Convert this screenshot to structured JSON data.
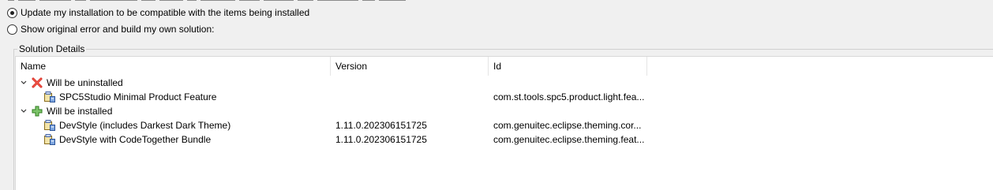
{
  "options": {
    "update_label": "Update my installation to be compatible with the items being installed",
    "update_selected": true,
    "show_error_label": "Show original error and build my own solution:",
    "show_error_selected": false
  },
  "solution": {
    "legend": "Solution Details",
    "columns": {
      "name": "Name",
      "version": "Version",
      "id": "Id"
    },
    "groups": [
      {
        "label": "Will be uninstalled",
        "icon": "red-x-icon",
        "expanded": true,
        "items": [
          {
            "name": "SPC5Studio Minimal Product Feature",
            "version": "",
            "id": "com.st.tools.spc5.product.light.fea..."
          }
        ]
      },
      {
        "label": "Will be installed",
        "icon": "green-plus-icon",
        "expanded": true,
        "items": [
          {
            "name": "DevStyle (includes Darkest Dark Theme)",
            "version": "1.11.0.202306151725",
            "id": "com.genuitec.eclipse.theming.cor..."
          },
          {
            "name": "DevStyle with CodeTogether Bundle",
            "version": "1.11.0.202306151725",
            "id": "com.genuitec.eclipse.theming.feat..."
          }
        ]
      }
    ]
  }
}
